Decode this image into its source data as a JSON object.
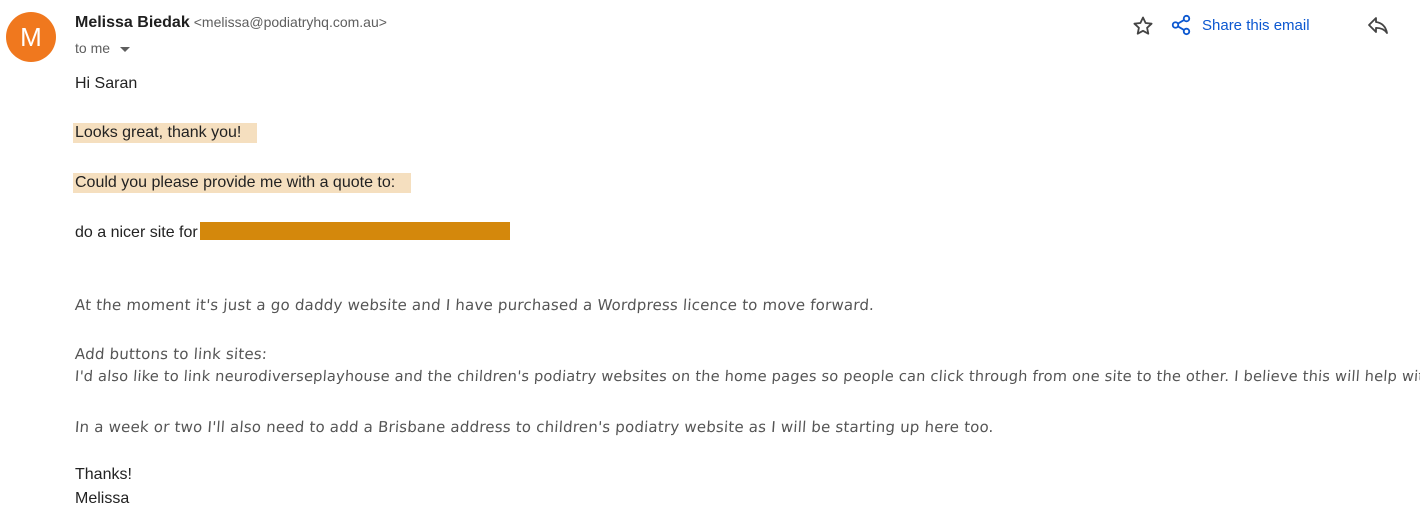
{
  "header": {
    "avatar_letter": "M",
    "sender_name": "Melissa Biedak",
    "sender_email": "<melissa@podiatryhq.com.au>",
    "recipient_text": "to me",
    "share_label": "Share this email"
  },
  "message": {
    "greeting": "Hi Saran",
    "line1": "Looks great, thank you!",
    "line2": "Could you please provide me with a quote to:",
    "line3": "do a nicer site for",
    "para1": "At the moment it's just a go daddy website and I have purchased a Wordpress licence to move forward.",
    "para2_a": "Add buttons to link sites:",
    "para2_b": "I'd also like to link neurodiverseplayhouse and the children's podiatry websites on the home pages so people can click through from one site to the other. I believe this will help with SEO?",
    "para3": "In a week or two I'll also need to add a Brisbane address to children's podiatry website as I will be starting up here too.",
    "signoff": "Thanks!",
    "signature": "Melissa"
  },
  "colors": {
    "avatar": "#f0781e",
    "highlight": "#f5dfbf",
    "redaction": "#d4880c",
    "link": "#0b57d0"
  }
}
